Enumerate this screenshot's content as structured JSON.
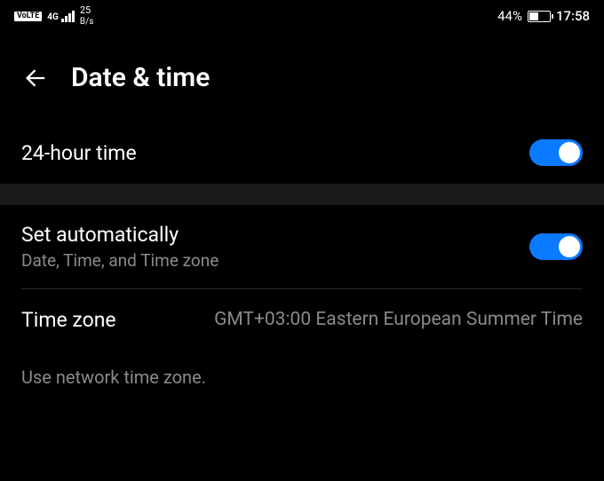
{
  "status": {
    "volte": "VoLTE",
    "network_type": "4G",
    "speed_value": "25",
    "speed_unit": "B/s",
    "battery_pct": "44%",
    "clock": "17:58"
  },
  "header": {
    "title": "Date & time"
  },
  "rows": {
    "twentyfourhour": {
      "label": "24-hour time"
    },
    "setauto": {
      "label": "Set automatically",
      "sublabel": "Date, Time, and Time zone"
    },
    "timezone": {
      "label": "Time zone",
      "value": "GMT+03:00 Eastern European Summer Time"
    },
    "timezone_desc": "Use network time zone."
  }
}
